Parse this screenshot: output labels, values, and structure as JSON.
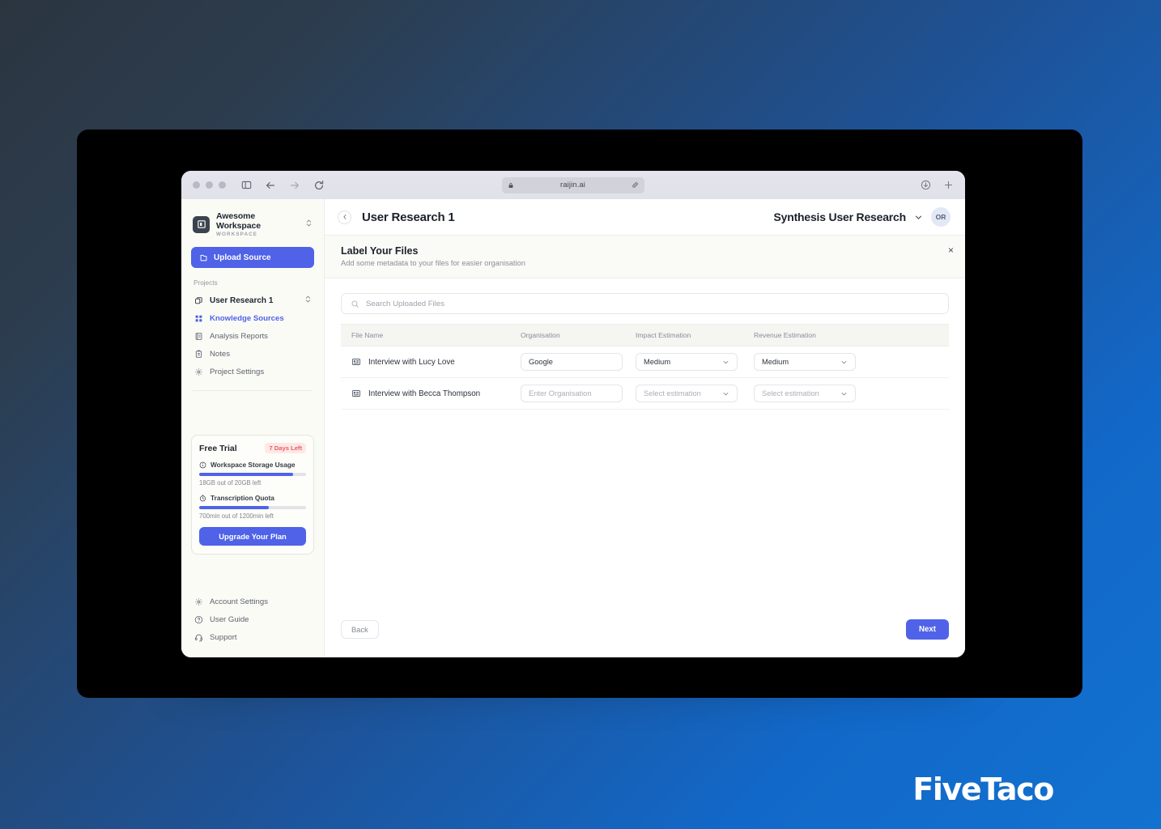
{
  "browser": {
    "url": "raijin.ai",
    "lock_icon": "lock-icon",
    "share_icon": "link-icon",
    "back_icon": "arrow-left-icon",
    "forward_icon": "arrow-right-icon",
    "reload_icon": "reload-icon",
    "sidebar_toggle_icon": "sidebar-toggle-icon",
    "download_icon": "download-icon",
    "newtab_icon": "plus-icon"
  },
  "sidebar": {
    "workspace": {
      "name": "Awesome Workspace",
      "subtitle": "WORKSPACE",
      "logo_icon": "workspace-logo-icon",
      "switch_icon": "chevron-up-down-icon"
    },
    "upload_button": {
      "label": "Upload Source",
      "icon": "upload-source-icon"
    },
    "projects_label": "Projects",
    "project": {
      "name": "User Research 1",
      "icon": "copy-icon",
      "switch_icon": "chevron-up-down-icon"
    },
    "nav_items": [
      {
        "label": "Knowledge Sources",
        "icon": "grid-icon",
        "active": true
      },
      {
        "label": "Analysis Reports",
        "icon": "report-icon",
        "active": false
      },
      {
        "label": "Notes",
        "icon": "notes-icon",
        "active": false
      },
      {
        "label": "Project Settings",
        "icon": "gear-icon",
        "active": false
      }
    ],
    "trial": {
      "title": "Free Trial",
      "badge": "7 Days Left",
      "storage": {
        "label": "Workspace Storage Usage",
        "icon": "info-circle-icon",
        "note": "18GB out of 20GB left",
        "percent": 88
      },
      "transcription": {
        "label": "Transcription Quota",
        "icon": "clock-icon",
        "note": "700min out of 1200min left",
        "percent": 65
      },
      "upgrade_label": "Upgrade Your Plan"
    },
    "bottom_items": [
      {
        "label": "Account Settings",
        "icon": "gear-icon"
      },
      {
        "label": "User Guide",
        "icon": "question-circle-icon"
      },
      {
        "label": "Support",
        "icon": "headset-icon"
      }
    ]
  },
  "topbar": {
    "back_icon": "chevron-left-icon",
    "title": "User Research 1",
    "synthesis_name": "Synthesis User Research",
    "synthesis_chevron": "chevron-down-icon",
    "avatar_initials": "OR"
  },
  "modal": {
    "title": "Label Your Files",
    "subtitle": "Add some metadata to your files for easier organisation",
    "close_icon": "close-icon",
    "close_label": "×"
  },
  "search": {
    "placeholder": "Search Uploaded Files",
    "value": "",
    "icon": "search-icon"
  },
  "table": {
    "columns": [
      "File Name",
      "Organisation",
      "Impact Estimation",
      "Revenue Estimation"
    ],
    "rows": [
      {
        "file_icon": "media-file-icon",
        "file_name": "Interview with Lucy Love",
        "organisation": {
          "value": "Google",
          "placeholder": "Enter Organisation"
        },
        "impact": {
          "value": "Medium",
          "placeholder": "Select estimation"
        },
        "revenue": {
          "value": "Medium",
          "placeholder": "Select estimation"
        }
      },
      {
        "file_icon": "media-file-icon",
        "file_name": "Interview with Becca Thompson",
        "organisation": {
          "value": "",
          "placeholder": "Enter Organisation"
        },
        "impact": {
          "value": "",
          "placeholder": "Select estimation"
        },
        "revenue": {
          "value": "",
          "placeholder": "Select estimation"
        }
      }
    ]
  },
  "footer": {
    "back_label": "Back",
    "next_label": "Next"
  },
  "watermark": "FiveTaco",
  "colors": {
    "accent": "#4f62e8",
    "badge_text": "#f05a5a",
    "badge_bg": "#fde9e7",
    "page_bg_start": "#2b3540",
    "page_bg_end": "#1272d0"
  }
}
